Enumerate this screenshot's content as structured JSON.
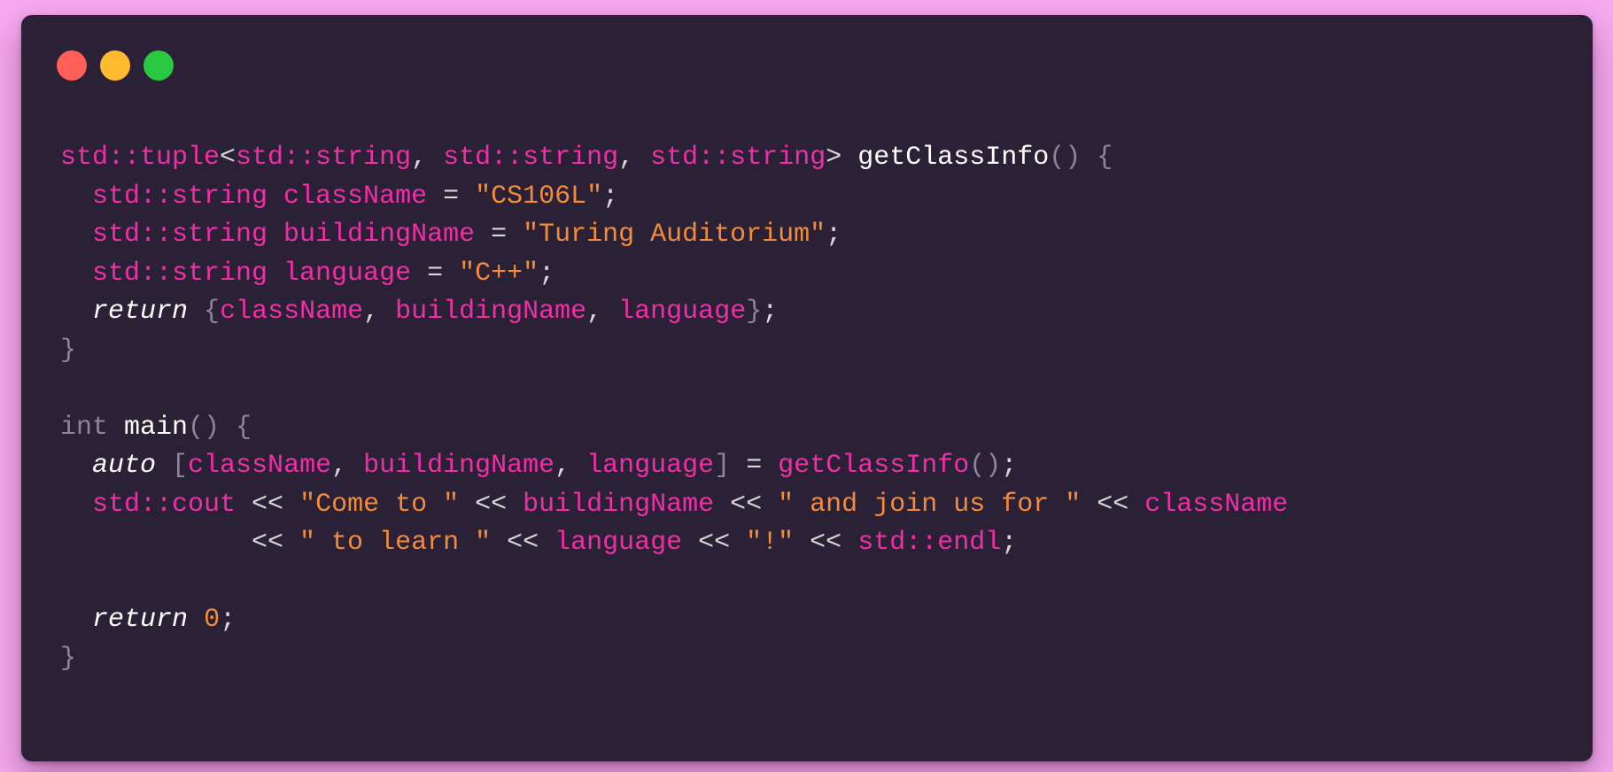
{
  "window": {
    "accent_colors": {
      "close": "#fe5f57",
      "minimize": "#febc2e",
      "zoom": "#28c840",
      "background": "#2a2136",
      "page_background": "#f7a8ef",
      "keyword": "#ef2fa5",
      "string": "#f28c3a"
    }
  },
  "code": {
    "lines": [
      [
        {
          "t": "std::tuple",
          "c": "kw"
        },
        {
          "t": "<",
          "c": "pl"
        },
        {
          "t": "std::string",
          "c": "kw"
        },
        {
          "t": ", ",
          "c": "pl"
        },
        {
          "t": "std::string",
          "c": "kw"
        },
        {
          "t": ", ",
          "c": "pl"
        },
        {
          "t": "std::string",
          "c": "kw"
        },
        {
          "t": "> ",
          "c": "pl"
        },
        {
          "t": "getClassInfo",
          "c": "fn"
        },
        {
          "t": "() {",
          "c": "dim"
        }
      ],
      [
        {
          "t": "  std::string ",
          "c": "kw"
        },
        {
          "t": "className",
          "c": "kw"
        },
        {
          "t": " = ",
          "c": "pl"
        },
        {
          "t": "\"CS106L\"",
          "c": "str"
        },
        {
          "t": ";",
          "c": "pl"
        }
      ],
      [
        {
          "t": "  std::string ",
          "c": "kw"
        },
        {
          "t": "buildingName",
          "c": "kw"
        },
        {
          "t": " = ",
          "c": "pl"
        },
        {
          "t": "\"Turing Auditorium\"",
          "c": "str"
        },
        {
          "t": ";",
          "c": "pl"
        }
      ],
      [
        {
          "t": "  std::string ",
          "c": "kw"
        },
        {
          "t": "language",
          "c": "kw"
        },
        {
          "t": " = ",
          "c": "pl"
        },
        {
          "t": "\"C++\"",
          "c": "str"
        },
        {
          "t": ";",
          "c": "pl"
        }
      ],
      [
        {
          "t": "  ",
          "c": "pl"
        },
        {
          "t": "return",
          "c": "it"
        },
        {
          "t": " {",
          "c": "dim"
        },
        {
          "t": "className",
          "c": "kw"
        },
        {
          "t": ", ",
          "c": "pl"
        },
        {
          "t": "buildingName",
          "c": "kw"
        },
        {
          "t": ", ",
          "c": "pl"
        },
        {
          "t": "language",
          "c": "kw"
        },
        {
          "t": "}",
          "c": "dim"
        },
        {
          "t": ";",
          "c": "pl"
        }
      ],
      [
        {
          "t": "}",
          "c": "dim"
        }
      ],
      [],
      [
        {
          "t": "int ",
          "c": "dim"
        },
        {
          "t": "main",
          "c": "fn"
        },
        {
          "t": "() {",
          "c": "dim"
        }
      ],
      [
        {
          "t": "  ",
          "c": "pl"
        },
        {
          "t": "auto",
          "c": "it"
        },
        {
          "t": " [",
          "c": "dim"
        },
        {
          "t": "className",
          "c": "kw"
        },
        {
          "t": ", ",
          "c": "pl"
        },
        {
          "t": "buildingName",
          "c": "kw"
        },
        {
          "t": ", ",
          "c": "pl"
        },
        {
          "t": "language",
          "c": "kw"
        },
        {
          "t": "]",
          "c": "dim"
        },
        {
          "t": " = ",
          "c": "pl"
        },
        {
          "t": "getClassInfo",
          "c": "kw"
        },
        {
          "t": "()",
          "c": "dim"
        },
        {
          "t": ";",
          "c": "pl"
        }
      ],
      [
        {
          "t": "  std::cout",
          "c": "kw"
        },
        {
          "t": " << ",
          "c": "pl"
        },
        {
          "t": "\"Come to \"",
          "c": "str"
        },
        {
          "t": " << ",
          "c": "pl"
        },
        {
          "t": "buildingName",
          "c": "kw"
        },
        {
          "t": " << ",
          "c": "pl"
        },
        {
          "t": "\" and join us for \"",
          "c": "str"
        },
        {
          "t": " << ",
          "c": "pl"
        },
        {
          "t": "className",
          "c": "kw"
        }
      ],
      [
        {
          "t": "            << ",
          "c": "pl"
        },
        {
          "t": "\" to learn \"",
          "c": "str"
        },
        {
          "t": " << ",
          "c": "pl"
        },
        {
          "t": "language",
          "c": "kw"
        },
        {
          "t": " << ",
          "c": "pl"
        },
        {
          "t": "\"!\"",
          "c": "str"
        },
        {
          "t": " << ",
          "c": "pl"
        },
        {
          "t": "std::endl",
          "c": "kw"
        },
        {
          "t": ";",
          "c": "pl"
        }
      ],
      [],
      [
        {
          "t": "  ",
          "c": "pl"
        },
        {
          "t": "return",
          "c": "it"
        },
        {
          "t": " ",
          "c": "pl"
        },
        {
          "t": "0",
          "c": "str"
        },
        {
          "t": ";",
          "c": "pl"
        }
      ],
      [
        {
          "t": "}",
          "c": "dim"
        }
      ]
    ]
  }
}
